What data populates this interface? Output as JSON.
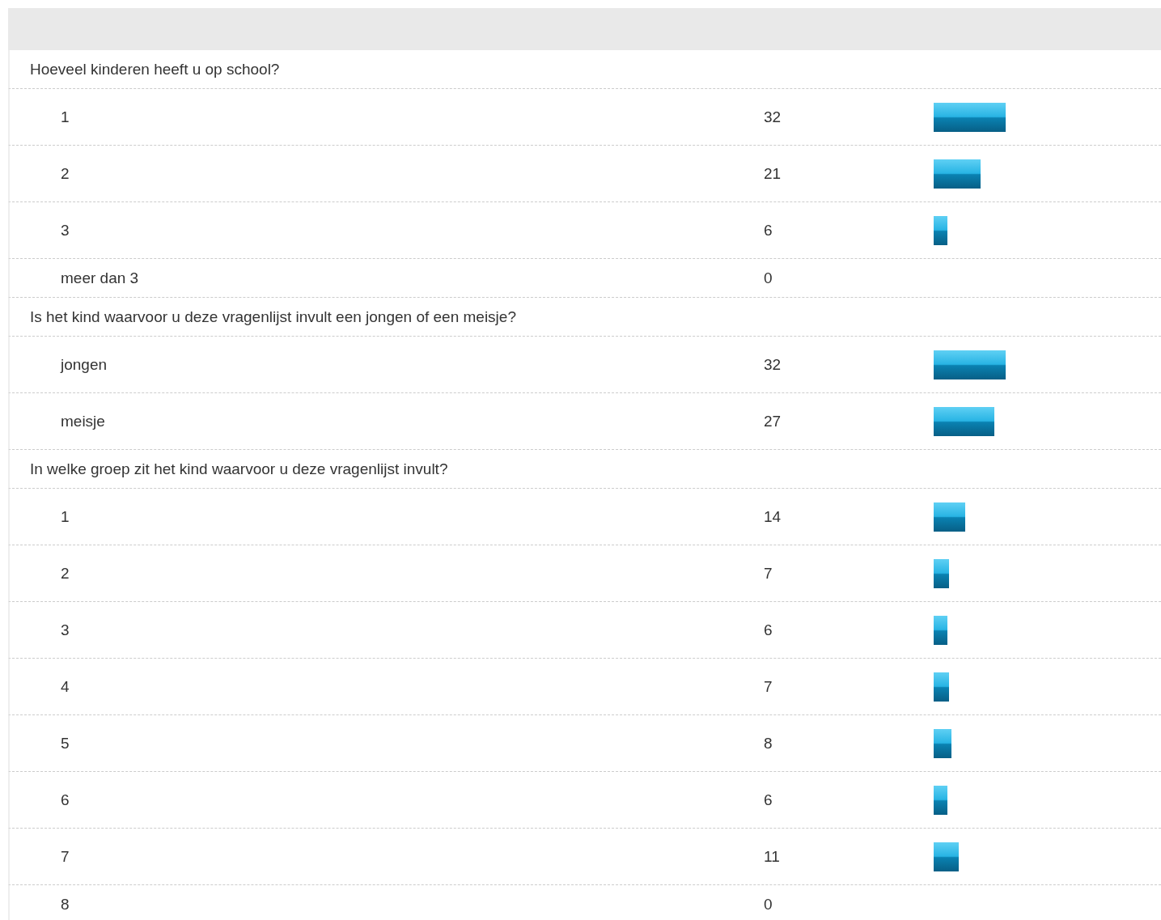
{
  "questions": [
    {
      "text": "Hoeveel kinderen heeft u op school?",
      "options": [
        {
          "label": "1",
          "count": "32"
        },
        {
          "label": "2",
          "count": "21"
        },
        {
          "label": "3",
          "count": "6"
        },
        {
          "label": "meer dan 3",
          "count": "0"
        }
      ]
    },
    {
      "text": "Is het kind waarvoor u deze vragenlijst invult een jongen of een meisje?",
      "options": [
        {
          "label": "jongen",
          "count": "32"
        },
        {
          "label": "meisje",
          "count": "27"
        }
      ]
    },
    {
      "text": "In welke groep zit het kind waarvoor u deze vragenlijst invult?",
      "options": [
        {
          "label": "1",
          "count": "14"
        },
        {
          "label": "2",
          "count": "7"
        },
        {
          "label": "3",
          "count": "6"
        },
        {
          "label": "4",
          "count": "7"
        },
        {
          "label": "5",
          "count": "8"
        },
        {
          "label": "6",
          "count": "6"
        },
        {
          "label": "7",
          "count": "11"
        },
        {
          "label": "8",
          "count": "0"
        }
      ]
    }
  ]
}
